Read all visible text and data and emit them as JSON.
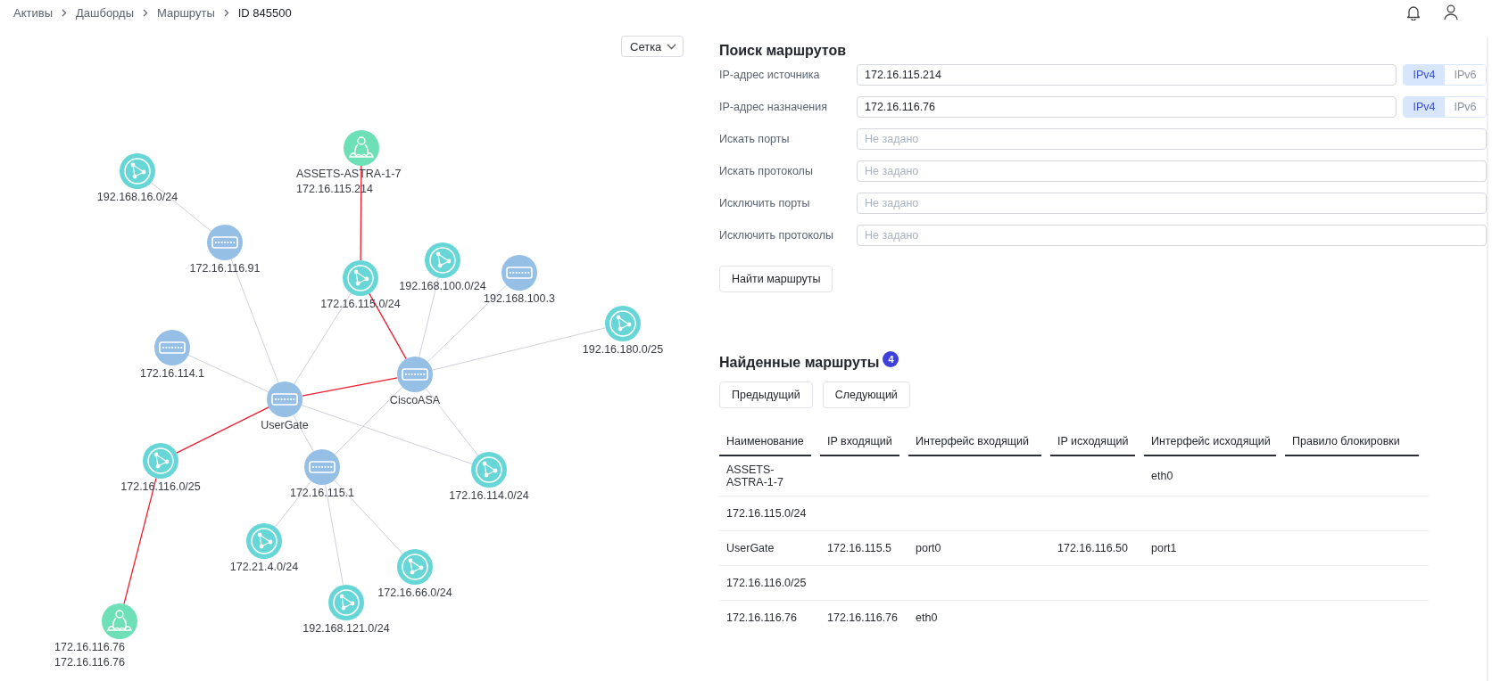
{
  "breadcrumbs": [
    "Активы",
    "Дашборды",
    "Маршруты",
    "ID 845500"
  ],
  "layout_select": {
    "value": "Сетка"
  },
  "graph": {
    "nodes": [
      {
        "kind": "host",
        "labels": [
          "ASSETS-ASTRA-1-7",
          "172.16.115.214"
        ]
      },
      {
        "kind": "network",
        "labels": [
          "192.168.16.0/24"
        ]
      },
      {
        "kind": "switch",
        "labels": [
          "172.16.116.91"
        ]
      },
      {
        "kind": "network",
        "labels": [
          "172.16.115.0/24"
        ]
      },
      {
        "kind": "network",
        "labels": [
          "192.168.100.0/24"
        ]
      },
      {
        "kind": "switch",
        "labels": [
          "192.168.100.3"
        ]
      },
      {
        "kind": "network",
        "labels": [
          "192.16.180.0/25"
        ]
      },
      {
        "kind": "switch",
        "labels": [
          "172.16.114.1"
        ]
      },
      {
        "kind": "switch",
        "labels": [
          "CiscoASA"
        ]
      },
      {
        "kind": "switch",
        "labels": [
          "UserGate"
        ]
      },
      {
        "kind": "network",
        "labels": [
          "172.16.116.0/25"
        ]
      },
      {
        "kind": "switch",
        "labels": [
          "172.16.115.1"
        ]
      },
      {
        "kind": "network",
        "labels": [
          "172.16.114.0/24"
        ]
      },
      {
        "kind": "network",
        "labels": [
          "172.21.4.0/24"
        ]
      },
      {
        "kind": "network",
        "labels": [
          "172.16.66.0/24"
        ]
      },
      {
        "kind": "network",
        "labels": [
          "192.168.121.0/24"
        ]
      },
      {
        "kind": "host",
        "labels": [
          "172.16.116.76",
          "172.16.116.76"
        ]
      }
    ],
    "edges": [
      {
        "on_route": false
      },
      {
        "on_route": false
      },
      {
        "on_route": false
      },
      {
        "on_route": true
      },
      {
        "on_route": true
      },
      {
        "on_route": false
      },
      {
        "on_route": false
      },
      {
        "on_route": false
      },
      {
        "on_route": false
      },
      {
        "on_route": true
      },
      {
        "on_route": true
      },
      {
        "on_route": true
      },
      {
        "on_route": false
      },
      {
        "on_route": false
      },
      {
        "on_route": false
      },
      {
        "on_route": false
      },
      {
        "on_route": false
      },
      {
        "on_route": false
      },
      {
        "on_route": false
      }
    ]
  },
  "search": {
    "title": "Поиск маршрутов",
    "fields": [
      {
        "label": "IP-адрес источника",
        "value": "172.16.115.214",
        "versions": [
          {
            "label": "IPv4",
            "selected": true
          },
          {
            "label": "IPv6",
            "selected": false
          }
        ]
      },
      {
        "label": "IP-адрес назначения",
        "value": "172.16.116.76",
        "versions": [
          {
            "label": "IPv4",
            "selected": true
          },
          {
            "label": "IPv6",
            "selected": false
          }
        ]
      },
      {
        "label": "Искать порты",
        "placeholder": "Не задано"
      },
      {
        "label": "Искать протоколы",
        "placeholder": "Не задано"
      },
      {
        "label": "Исключить порты",
        "placeholder": "Не задано"
      },
      {
        "label": "Исключить протоколы",
        "placeholder": "Не задано"
      }
    ],
    "button": "Найти маршруты"
  },
  "results": {
    "title": "Найденные маршруты",
    "count": "4",
    "buttons": [
      "Предыдущий",
      "Следующий"
    ],
    "columns": [
      "Наименование",
      "IP входящий",
      "Интерфейс входящий",
      "IP исходящий",
      "Интерфейс исходящий",
      "Правило блокировки"
    ],
    "rows": [
      {
        "name": "ASSETS-ASTRA-1-7",
        "iface_out": "eth0"
      },
      {
        "name": "172.16.115.0/24"
      },
      {
        "name": "UserGate",
        "ip_in": "172.16.115.5",
        "iface_in": "port0",
        "ip_out": "172.16.116.50",
        "iface_out": "port1"
      },
      {
        "name": "172.16.116.0/25"
      },
      {
        "name": "172.16.116.76",
        "ip_in": "172.16.116.76",
        "iface_in": "eth0"
      }
    ]
  }
}
